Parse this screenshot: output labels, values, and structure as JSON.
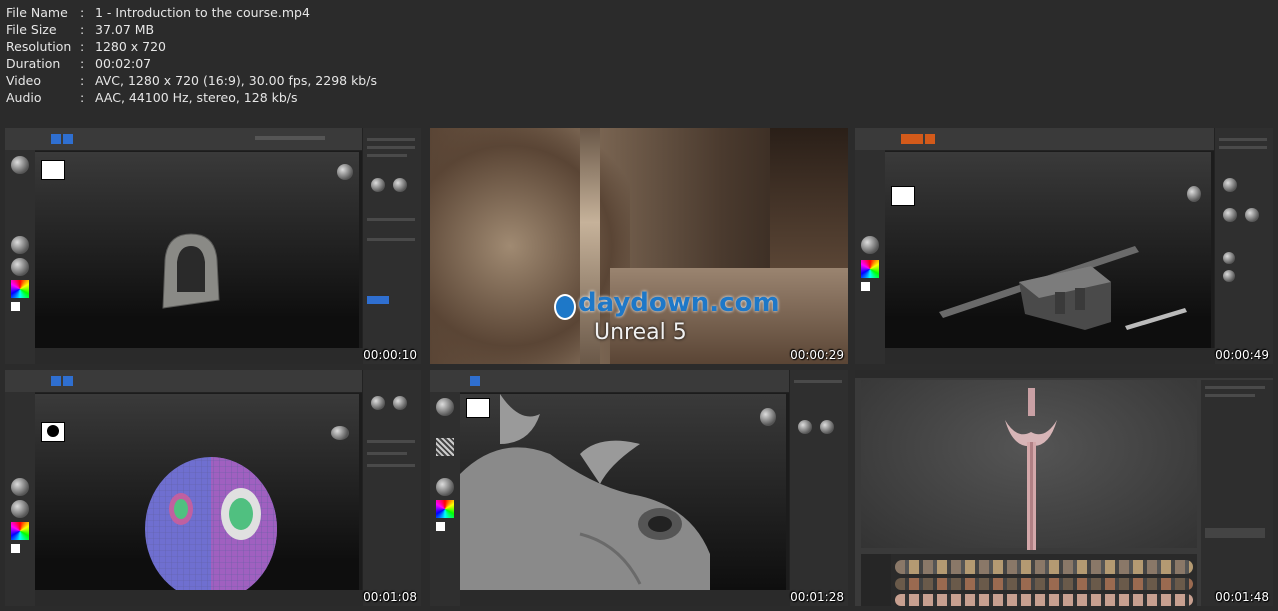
{
  "file_info": [
    {
      "key": "File Name",
      "value": "1 - Introduction to the course.mp4"
    },
    {
      "key": "File Size",
      "value": "37.07 MB"
    },
    {
      "key": "Resolution",
      "value": "1280 x 720"
    },
    {
      "key": "Duration",
      "value": "00:02:07"
    },
    {
      "key": "Video",
      "value": "AVC, 1280 x 720 (16:9), 30.00 fps, 2298 kb/s"
    },
    {
      "key": "Audio",
      "value": "AAC, 44100 Hz, stereo, 128 kb/s"
    }
  ],
  "separator": ":",
  "thumbnails": [
    {
      "timestamp": "00:00:10"
    },
    {
      "timestamp": "00:00:29",
      "watermark": "daydown.com",
      "subtitle": "Unreal 5"
    },
    {
      "timestamp": "00:00:49"
    },
    {
      "timestamp": "00:01:08"
    },
    {
      "timestamp": "00:01:28"
    },
    {
      "timestamp": "00:01:48"
    }
  ],
  "colors": {
    "background": "#2b2b2b",
    "watermark": "#1e78c8",
    "accent": "#2f6fd0"
  }
}
